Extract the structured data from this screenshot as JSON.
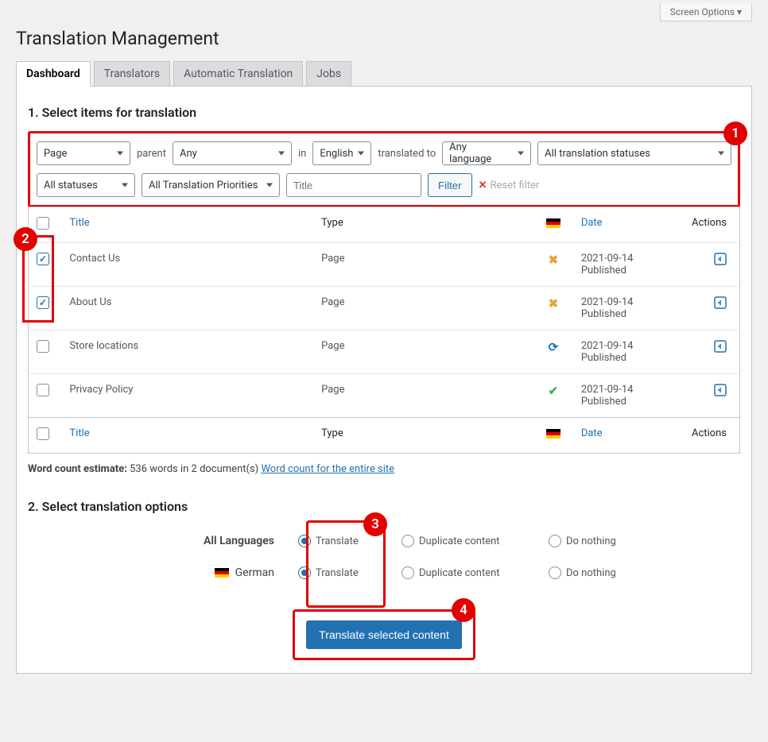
{
  "screen_options": "Screen Options ▾",
  "page_title": "Translation Management",
  "tabs": [
    "Dashboard",
    "Translators",
    "Automatic Translation",
    "Jobs"
  ],
  "step1_title": "1. Select items for translation",
  "filters": {
    "post_type": "Page",
    "parent_label": "parent",
    "parent_value": "Any",
    "in_label": "in",
    "language": "English",
    "translated_to_label": "translated to",
    "target_lang": "Any language",
    "status_translation": "All translation statuses",
    "status_post": "All statuses",
    "priority": "All Translation Priorities",
    "title_placeholder": "Title",
    "filter_btn": "Filter",
    "reset": "Reset filter"
  },
  "table_headers": {
    "title": "Title",
    "type": "Type",
    "date": "Date",
    "actions": "Actions"
  },
  "rows": [
    {
      "title": "Contact Us",
      "type": "Page",
      "status_icon": "x",
      "date": "2021-09-14",
      "state": "Published",
      "checked": true
    },
    {
      "title": "About Us",
      "type": "Page",
      "status_icon": "x",
      "date": "2021-09-14",
      "state": "Published",
      "checked": true
    },
    {
      "title": "Store locations",
      "type": "Page",
      "status_icon": "refresh",
      "date": "2021-09-14",
      "state": "Published",
      "checked": false
    },
    {
      "title": "Privacy Policy",
      "type": "Page",
      "status_icon": "check",
      "date": "2021-09-14",
      "state": "Published",
      "checked": false
    }
  ],
  "word_count": {
    "label": "Word count estimate:",
    "value": "536 words in 2 document(s)",
    "link": "Word count for the entire site"
  },
  "step2_title": "2. Select translation options",
  "opts": {
    "all_lang": "All Languages",
    "german": "German",
    "translate": "Translate",
    "duplicate": "Duplicate content",
    "nothing": "Do nothing"
  },
  "submit_btn": "Translate selected content",
  "callouts": {
    "1": "1",
    "2": "2",
    "3": "3",
    "4": "4"
  }
}
